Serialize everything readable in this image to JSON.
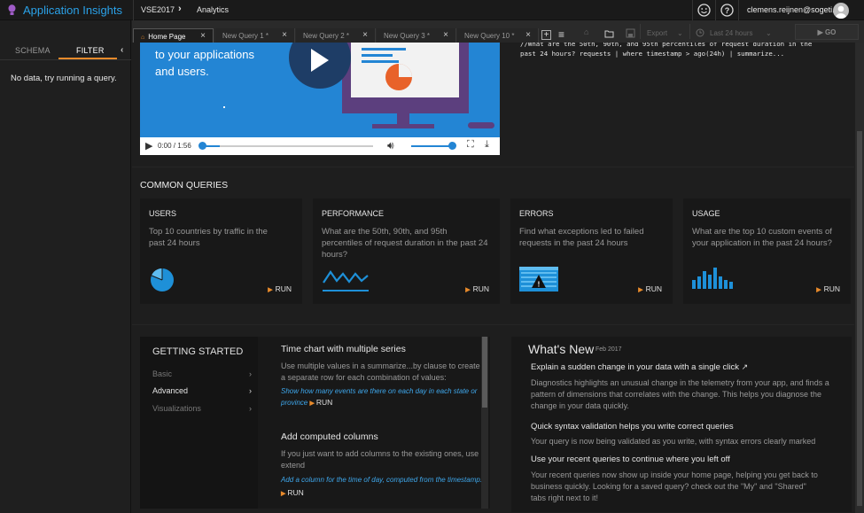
{
  "app": {
    "brand": "Application Insights",
    "breadcrumb": [
      "VSE2017",
      "Analytics"
    ],
    "user": "clemens.reijnen@sogeti.nl"
  },
  "sidebar": {
    "tabs": [
      "SCHEMA",
      "FILTER"
    ],
    "empty_message": "No data, try running a query."
  },
  "tabs": [
    {
      "label": "Home Page"
    },
    {
      "label": "New Query 1 *"
    },
    {
      "label": "New Query 2 *"
    },
    {
      "label": "New Query 3 *"
    },
    {
      "label": "New Query 10 *"
    }
  ],
  "toolbar": {
    "export": "Export",
    "timerange": "Last 24 hours",
    "go": "GO"
  },
  "video": {
    "line1": "to your applications",
    "line2": "and users.",
    "time": "0:00 / 1:56"
  },
  "query_preview": "//What are the 50th, 90th, and 95th percentiles of request duration in the past 24 hours? requests | where timestamp > ago(24h) | summarize...",
  "common_queries": {
    "title": "COMMON QUERIES",
    "run_label": "RUN",
    "cards": [
      {
        "title": "USERS",
        "desc": "Top 10 countries by traffic in the past 24 hours",
        "icon": "pie-chart-icon"
      },
      {
        "title": "PERFORMANCE",
        "desc": "What are the 50th, 90th, and 95th percentiles of request duration in the past 24 hours?",
        "icon": "line-chart-icon"
      },
      {
        "title": "ERRORS",
        "desc": "Find what exceptions led to failed requests in the past 24 hours",
        "icon": "warning-window-icon"
      },
      {
        "title": "USAGE",
        "desc": "What are the top 10 custom events of your application in the past 24 hours?",
        "icon": "bar-chart-icon"
      }
    ]
  },
  "getting_started": {
    "title": "GETTING STARTED",
    "nav": [
      {
        "label": "Basic"
      },
      {
        "label": "Advanced"
      },
      {
        "label": "Visualizations"
      }
    ],
    "sections": [
      {
        "heading": "Time chart with multiple series",
        "text": "Use multiple values in a summarize...by clause to create a separate row for each combination of values:",
        "link": "Show how many events are there on each day in each state or province",
        "run": "RUN"
      },
      {
        "heading": "Add computed columns",
        "text": "If you just want to add columns to the existing ones, use extend",
        "link": "Add a column for the time of day, computed from the timestamp.",
        "run": "RUN"
      }
    ]
  },
  "whats_new": {
    "title": "What's New",
    "date": "Feb 2017",
    "items": [
      {
        "heading": "Explain a sudden change in your data with a single click",
        "text": "Diagnostics highlights an unusual change in the telemetry from your app, and finds a pattern of dimensions that correlates with the change. This helps you diagnose the change in your data quickly."
      },
      {
        "heading": "Quick syntax validation helps you write correct queries",
        "text": "Your query is now being validated as you write, with syntax errors clearly marked"
      },
      {
        "heading": "Use your recent queries to continue where you left off",
        "text": "Your recent queries now show up inside your home page, helping you get back to business quickly. Looking for a saved query? check out the \"My\" and \"Shared\" tabs right next to it!"
      }
    ]
  }
}
